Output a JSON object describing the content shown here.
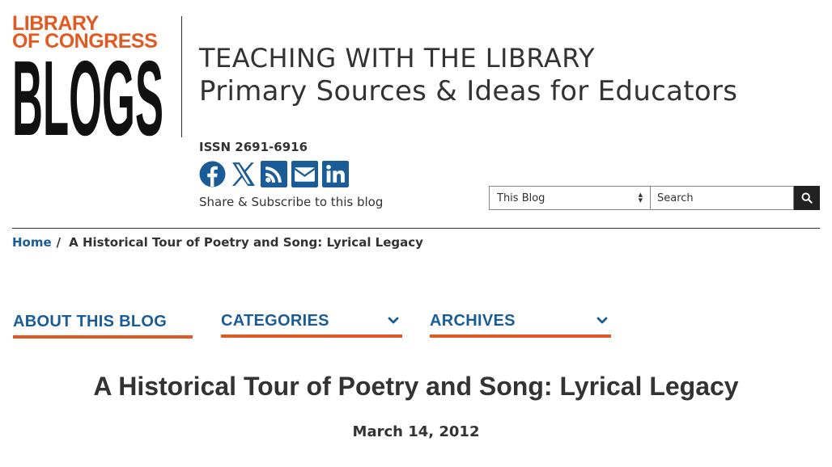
{
  "logo": {
    "line1": "LIBRARY",
    "line2": "OF CONGRESS",
    "line3": "BLOGS",
    "accent_color": "#e05a22"
  },
  "blog": {
    "title": "TEACHING WITH THE LIBRARY",
    "subtitle": "Primary Sources & Ideas for Educators",
    "issn": "ISSN 2691-6916",
    "share_text": "Share & Subscribe to this blog"
  },
  "social_icons": [
    "facebook-icon",
    "x-twitter-icon",
    "rss-icon",
    "email-icon",
    "linkedin-icon"
  ],
  "search": {
    "scope_value": "This Blog",
    "placeholder": "Search",
    "button_icon": "search-icon"
  },
  "breadcrumb": {
    "home": "Home",
    "separator": "/",
    "current": "A Historical Tour of Poetry and Song: Lyrical Legacy"
  },
  "nav": {
    "about": "ABOUT THIS BLOG",
    "categories": "CATEGORIES",
    "archives": "ARCHIVES"
  },
  "post": {
    "title": "A Historical Tour of Poetry and Song: Lyrical Legacy",
    "date": "March 14, 2012"
  },
  "colors": {
    "link_blue": "#1a5c98",
    "accent_orange": "#e05a22",
    "text": "#333333"
  }
}
